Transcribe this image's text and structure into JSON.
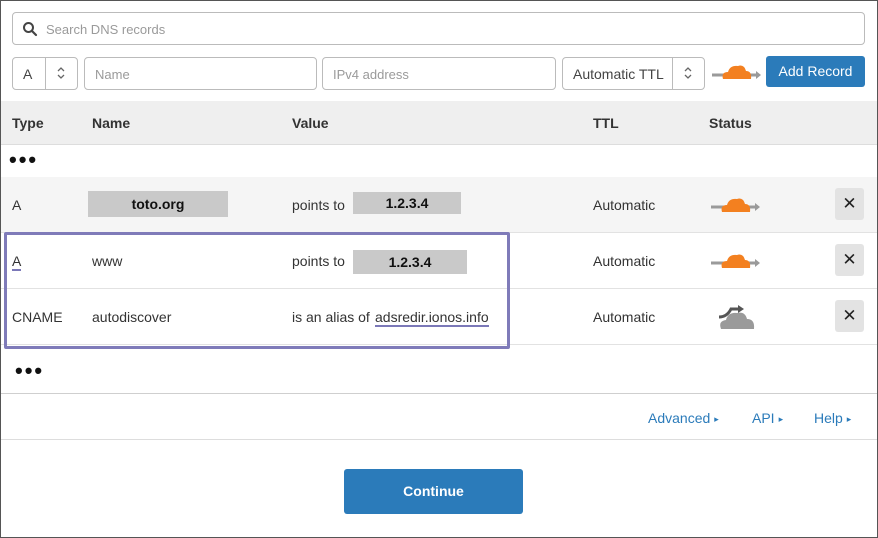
{
  "search": {
    "placeholder": "Search DNS records",
    "icon": "search-icon"
  },
  "add_form": {
    "type_value": "A",
    "name_placeholder": "Name",
    "value_placeholder": "IPv4 address",
    "ttl_value": "Automatic TTL",
    "add_label": "Add Record"
  },
  "table": {
    "headers": {
      "type": "Type",
      "name": "Name",
      "value": "Value",
      "ttl": "TTL",
      "status": "Status"
    },
    "ellipsis": "•••",
    "rows": [
      {
        "type": "A",
        "name": "toto.org",
        "value_prefix": "points to",
        "value": "1.2.3.4",
        "ttl": "Automatic",
        "status": "proxied",
        "delete_label": "✕"
      },
      {
        "type": "A",
        "name": "www",
        "value_prefix": "points to",
        "value": "1.2.3.4",
        "ttl": "Automatic",
        "status": "proxied",
        "delete_label": "✕"
      },
      {
        "type": "CNAME",
        "name": "autodiscover",
        "value_prefix": "is an alias of",
        "value": "adsredir.ionos.info",
        "ttl": "Automatic",
        "status": "dns-only",
        "delete_label": "✕"
      }
    ]
  },
  "footer": {
    "advanced": "Advanced",
    "api": "API",
    "help": "Help",
    "caret": "▸"
  },
  "continue_label": "Continue",
  "colors": {
    "accent": "#2b7bba",
    "cloud_orange": "#f38020",
    "cloud_gray": "#9a9a9a",
    "highlight": "#7f7bb9"
  }
}
